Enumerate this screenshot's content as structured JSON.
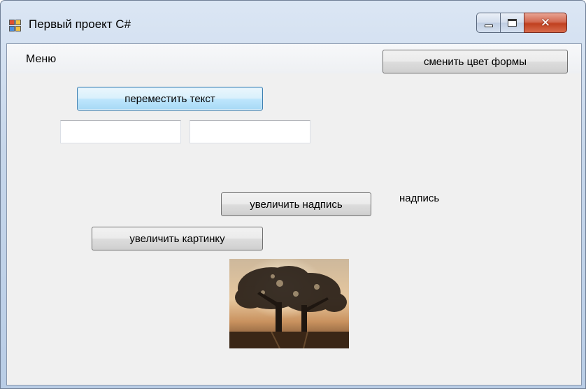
{
  "window": {
    "title": "Первый проект C#"
  },
  "menu": {
    "items": [
      "Меню"
    ]
  },
  "buttons": {
    "change_color": "сменить цвет формы",
    "move_text": "переместить текст",
    "enlarge_label": "увеличить надпись",
    "enlarge_picture": "увеличить картинку"
  },
  "textboxes": {
    "first": "",
    "second": ""
  },
  "label": {
    "text": "надпись"
  },
  "picture": {
    "subject": "trees-at-sunset"
  },
  "colors": {
    "client_bg": "#f0f0f0",
    "close_button": "#c0401f",
    "focus_border": "#3c7fb1"
  }
}
